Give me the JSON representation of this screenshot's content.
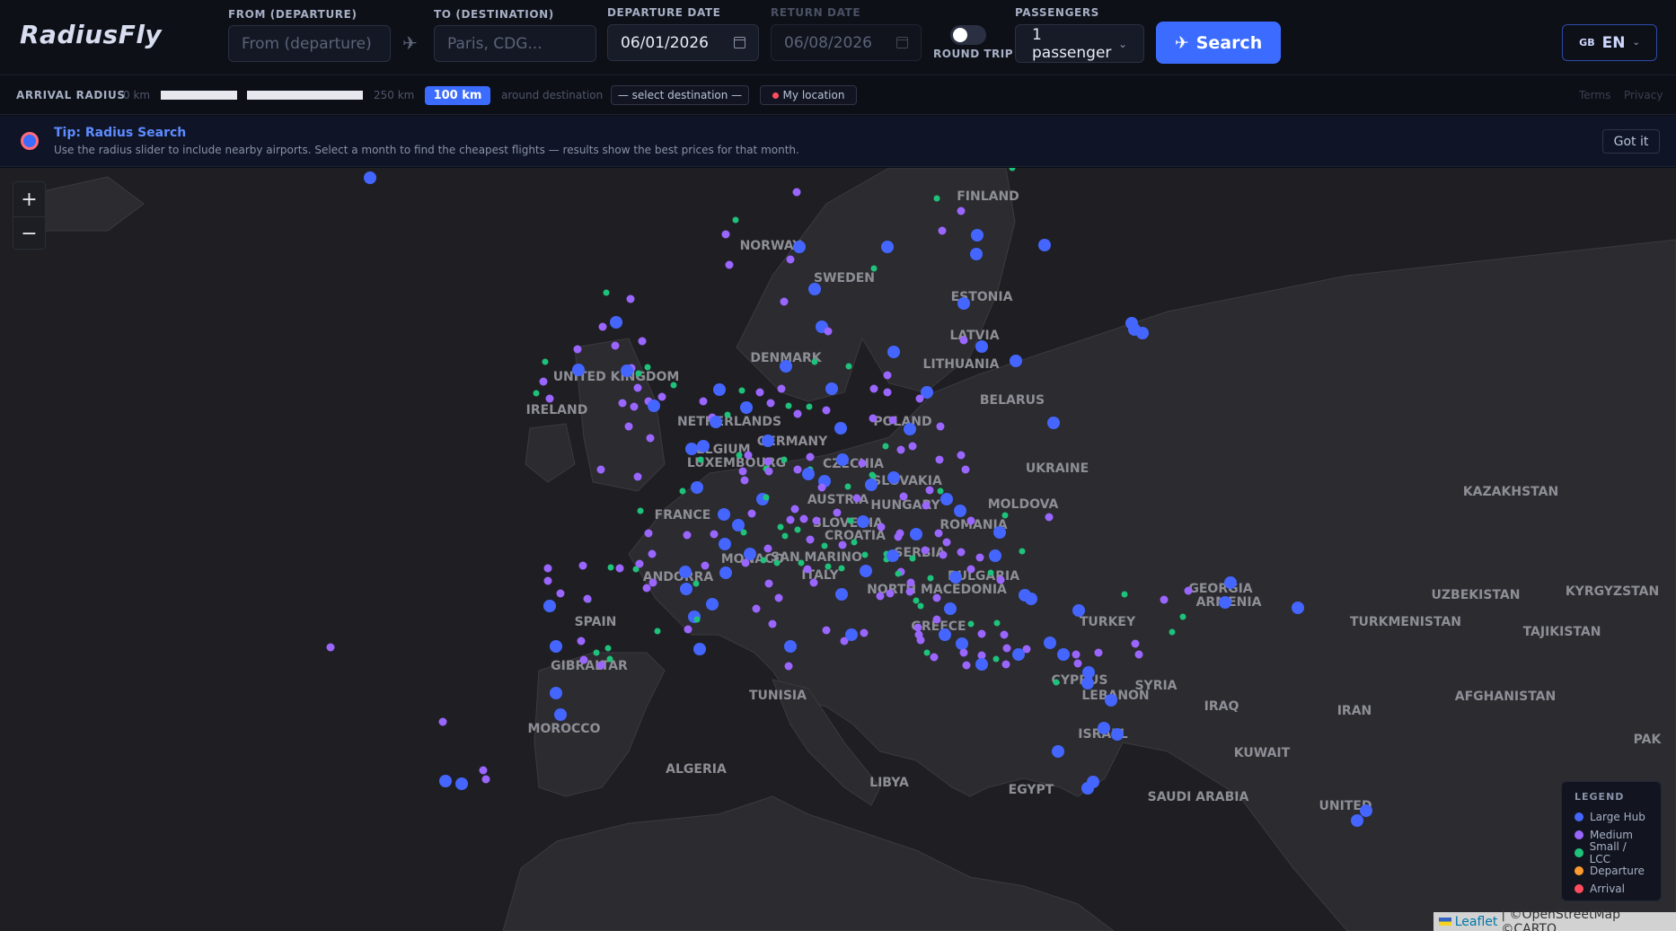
{
  "header": {
    "logo": "RadiusFly",
    "from_label": "FROM (DEPARTURE)",
    "from_placeholder": "From (departure)",
    "to_label": "TO (DESTINATION)",
    "to_placeholder": "Paris, CDG...",
    "departure_label": "DEPARTURE DATE",
    "departure_value": "06/01/2026",
    "return_label": "RETURN DATE",
    "return_value": "06/08/2026",
    "round_trip_label": "ROUND TRIP",
    "passengers_label": "PASSENGERS",
    "passengers_value": "1 passenger",
    "search_label": "Search",
    "lang_flag": "GB",
    "lang_value": "EN"
  },
  "radius": {
    "label": "ARRIVAL RADIUS",
    "min": "0 km",
    "max": "250 km",
    "value": "100 km",
    "value_km": 100,
    "around": "around destination",
    "destination_select": "— select destination —",
    "my_location": "My location",
    "terms": "Terms",
    "privacy": "Privacy"
  },
  "tip": {
    "title": "Tip: Radius Search",
    "text": "Use the radius slider to include nearby airports. Select a month to find the cheapest flights — results show the best prices for that month.",
    "dismiss": "Got it"
  },
  "colors": {
    "large": "#4466ff",
    "medium": "#9a66ff",
    "small": "#1fc27a",
    "departure": "#ff9a2e",
    "arrival": "#ff4d5e",
    "accent": "#3b6cff"
  },
  "map": {
    "zoom_in": "+",
    "zoom_out": "−",
    "countries": [
      {
        "name": "FINLAND"
      },
      {
        "name": "NORWAY"
      },
      {
        "name": "SWEDEN"
      },
      {
        "name": "ESTONIA"
      },
      {
        "name": "LATVIA"
      },
      {
        "name": "LITHUANIA"
      },
      {
        "name": "DENMARK"
      },
      {
        "name": "UNITED KINGDOM"
      },
      {
        "name": "IRELAND"
      },
      {
        "name": "BELARUS"
      },
      {
        "name": "NETHERLANDS"
      },
      {
        "name": "POLAND"
      },
      {
        "name": "BELGIUM"
      },
      {
        "name": "GERMANY"
      },
      {
        "name": "LUXEMBOURG"
      },
      {
        "name": "CZECHIA"
      },
      {
        "name": "UKRAINE"
      },
      {
        "name": "SLOVAKIA"
      },
      {
        "name": "KAZAKHSTAN"
      },
      {
        "name": "FRANCE"
      },
      {
        "name": "AUSTRIA"
      },
      {
        "name": "HUNGARY"
      },
      {
        "name": "MOLDOVA"
      },
      {
        "name": "SLOVENIA"
      },
      {
        "name": "CROATIA"
      },
      {
        "name": "ROMANIA"
      },
      {
        "name": "SAN MARINO"
      },
      {
        "name": "MONACO"
      },
      {
        "name": "SERBIA"
      },
      {
        "name": "ANDORRA"
      },
      {
        "name": "ITALY"
      },
      {
        "name": "BULGARIA"
      },
      {
        "name": "GEORGIA"
      },
      {
        "name": "ARMENIA"
      },
      {
        "name": "UZBEKISTAN"
      },
      {
        "name": "KYRGYZSTAN"
      },
      {
        "name": "NORTH MACEDONIA"
      },
      {
        "name": "SPAIN"
      },
      {
        "name": "TURKEY"
      },
      {
        "name": "TURKMENISTAN"
      },
      {
        "name": "TAJIKISTAN"
      },
      {
        "name": "GREECE"
      },
      {
        "name": "GIBRALTAR"
      },
      {
        "name": "CYPRUS"
      },
      {
        "name": "SYRIA"
      },
      {
        "name": "TUNISIA"
      },
      {
        "name": "LEBANON"
      },
      {
        "name": "IRAQ"
      },
      {
        "name": "AFGHANISTAN"
      },
      {
        "name": "IRAN"
      },
      {
        "name": "MOROCCO"
      },
      {
        "name": "ISRAEL"
      },
      {
        "name": "PAK"
      },
      {
        "name": "KUWAIT"
      },
      {
        "name": "ALGERIA"
      },
      {
        "name": "LIBYA"
      },
      {
        "name": "EGYPT"
      },
      {
        "name": "SAUDI ARABIA"
      },
      {
        "name": "UNITED"
      }
    ]
  },
  "legend": {
    "title": "LEGEND",
    "items": [
      {
        "label": "Large Hub",
        "color": "#4466ff"
      },
      {
        "label": "Medium",
        "color": "#9a66ff"
      },
      {
        "label": "Small / LCC",
        "color": "#1fc27a"
      },
      {
        "label": "Departure",
        "color": "#ff9a2e"
      },
      {
        "label": "Arrival",
        "color": "#ff4d5e"
      }
    ]
  },
  "attribution": {
    "leaflet": "Leaflet",
    "rest": "| ©OpenStreetMap ©CARTO"
  }
}
